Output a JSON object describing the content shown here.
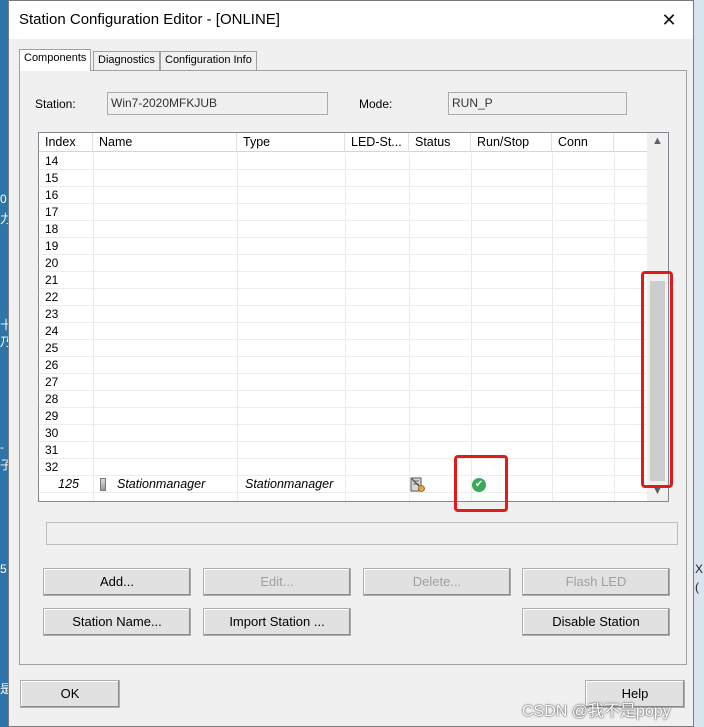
{
  "window": {
    "title": "Station Configuration Editor - [ONLINE]"
  },
  "tabs": [
    {
      "label": "Components"
    },
    {
      "label": "Diagnostics"
    },
    {
      "label": "Configuration Info"
    }
  ],
  "station": {
    "label": "Station:",
    "value": "Win7-2020MFKJUB"
  },
  "mode": {
    "label": "Mode:",
    "value": "RUN_P"
  },
  "table": {
    "columns": [
      "Index",
      "Name",
      "Type",
      "LED-St...",
      "Status",
      "Run/Stop",
      "Conn"
    ],
    "rows": [
      {
        "index": "14"
      },
      {
        "index": "15"
      },
      {
        "index": "16"
      },
      {
        "index": "17"
      },
      {
        "index": "18"
      },
      {
        "index": "19"
      },
      {
        "index": "20"
      },
      {
        "index": "21"
      },
      {
        "index": "22"
      },
      {
        "index": "23"
      },
      {
        "index": "24"
      },
      {
        "index": "25"
      },
      {
        "index": "26"
      },
      {
        "index": "27"
      },
      {
        "index": "28"
      },
      {
        "index": "29"
      },
      {
        "index": "30"
      },
      {
        "index": "31"
      },
      {
        "index": "32"
      }
    ],
    "station_manager": {
      "index": "125",
      "name": "Stationmanager",
      "type": "Stationmanager",
      "status_icon": "module-status-icon",
      "run_icon": "check-circle-icon",
      "run_color": "#3ba85a"
    }
  },
  "buttons": {
    "add": "Add...",
    "edit": "Edit...",
    "delete": "Delete...",
    "flash_led": "Flash LED",
    "station_name": "Station Name...",
    "import_station": "Import Station ...",
    "disable_station": "Disable Station",
    "ok": "OK",
    "help": "Help"
  },
  "highlight_color": "#e31a1a",
  "watermark": "CSDN @我不是popy"
}
